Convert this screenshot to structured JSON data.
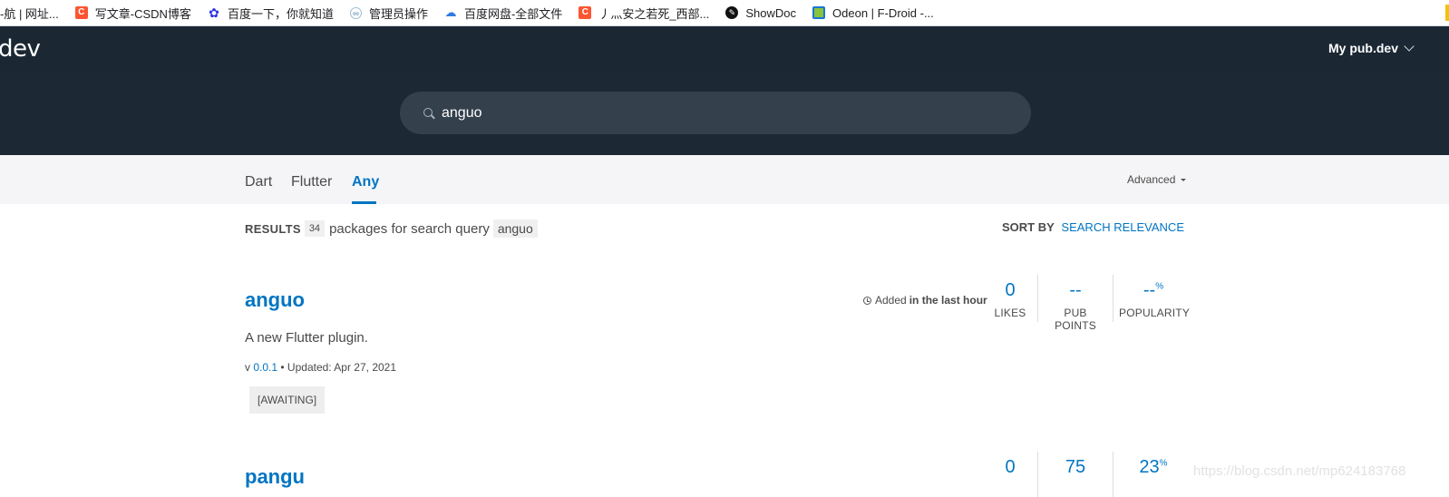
{
  "bookmarks": [
    {
      "icon": "none",
      "label": "-航 | 网址..."
    },
    {
      "icon": "csdn-icon",
      "glyph": "C",
      "label": "写文章-CSDN博客"
    },
    {
      "icon": "baidu-icon",
      "glyph": "✿",
      "label": "百度一下，你就知道"
    },
    {
      "icon": "admin-icon",
      "glyph": "∞",
      "label": "管理员操作"
    },
    {
      "icon": "baidu-pan-icon",
      "glyph": "☁",
      "label": "百度网盘-全部文件"
    },
    {
      "icon": "csdn-icon",
      "glyph": "C",
      "label": "丿灬安之若死_西部..."
    },
    {
      "icon": "showdoc-icon",
      "glyph": "✎",
      "label": "ShowDoc"
    },
    {
      "icon": "fdroid-icon",
      "glyph": "",
      "label": "Odeon | F-Droid -..."
    }
  ],
  "header": {
    "logo": "dev",
    "my_pub": "My pub.dev"
  },
  "search": {
    "value": "anguo"
  },
  "tabs": [
    {
      "label": "Dart",
      "active": false
    },
    {
      "label": "Flutter",
      "active": false
    },
    {
      "label": "Any",
      "active": true
    }
  ],
  "advanced_label": "Advanced",
  "results": {
    "label": "RESULTS",
    "count": "34",
    "text": "packages for search query",
    "query": "anguo"
  },
  "sort": {
    "label": "SORT BY",
    "value": "SEARCH RELEVANCE"
  },
  "packages": [
    {
      "name": "anguo",
      "description": "A new Flutter plugin.",
      "version_prefix": "v",
      "version": "0.0.1",
      "updated": "• Updated: Apr 27, 2021",
      "tag": "[AWAITING]",
      "added_prefix": "Added",
      "added_when": "in the last hour",
      "likes": "0",
      "pub_points": "--",
      "popularity": "--",
      "popularity_unit": "%"
    },
    {
      "name": "pangu",
      "likes": "0",
      "pub_points": "75",
      "popularity": "23",
      "popularity_unit": "%"
    }
  ],
  "metric_labels": {
    "likes": "LIKES",
    "pub_points": "PUB POINTS",
    "popularity": "POPULARITY"
  },
  "watermark": "https://blog.csdn.net/mp624183768",
  "colors": {
    "accent": "#0175c2",
    "header_bg": "#1b2834",
    "search_bg": "#35404d",
    "tabs_bg": "#f5f5f7"
  }
}
